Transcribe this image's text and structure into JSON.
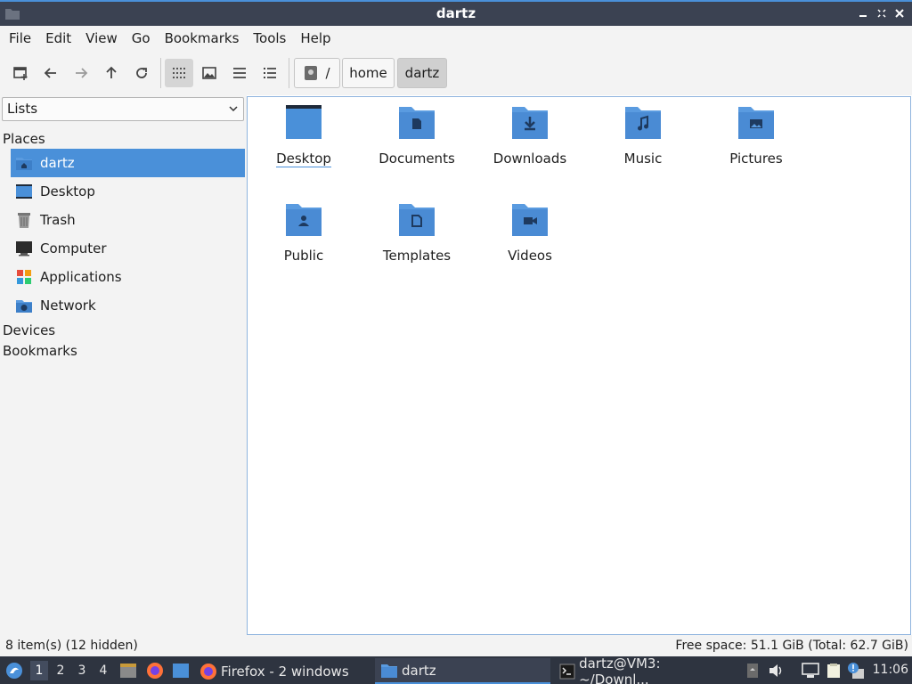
{
  "window": {
    "title": "dartz"
  },
  "menu": [
    "File",
    "Edit",
    "View",
    "Go",
    "Bookmarks",
    "Tools",
    "Help"
  ],
  "toolbar": {
    "buttons": [
      "new-window-icon",
      "back-icon",
      "forward-icon",
      "up-icon",
      "reload-icon",
      "icon-view-icon",
      "thumbnail-view-icon",
      "compact-view-icon",
      "detailed-list-view-icon"
    ],
    "active_view": "icon-view",
    "breadcrumbs": [
      "/",
      "home",
      "dartz"
    ]
  },
  "sidebar": {
    "combo": "Lists",
    "sections": {
      "places": "Places",
      "devices": "Devices",
      "bookmarks": "Bookmarks"
    },
    "places": [
      {
        "label": "dartz",
        "icon": "home-folder-icon",
        "selected": true
      },
      {
        "label": "Desktop",
        "icon": "desktop-icon"
      },
      {
        "label": "Trash",
        "icon": "trash-icon"
      },
      {
        "label": "Computer",
        "icon": "computer-icon"
      },
      {
        "label": "Applications",
        "icon": "applications-icon"
      },
      {
        "label": "Network",
        "icon": "network-icon"
      }
    ]
  },
  "files": [
    {
      "name": "Desktop",
      "icon": "desktop-folder-icon"
    },
    {
      "name": "Documents",
      "icon": "documents-folder-icon"
    },
    {
      "name": "Downloads",
      "icon": "downloads-folder-icon"
    },
    {
      "name": "Music",
      "icon": "music-folder-icon"
    },
    {
      "name": "Pictures",
      "icon": "pictures-folder-icon"
    },
    {
      "name": "Public",
      "icon": "public-folder-icon"
    },
    {
      "name": "Templates",
      "icon": "templates-folder-icon"
    },
    {
      "name": "Videos",
      "icon": "videos-folder-icon"
    }
  ],
  "status": {
    "left": "8 item(s) (12 hidden)",
    "right": "Free space: 51.1 GiB (Total: 62.7 GiB)"
  },
  "taskbar": {
    "workspaces": [
      "1",
      "2",
      "3",
      "4"
    ],
    "tasks": [
      {
        "label": "Firefox - 2 windows",
        "icon": "firefox-icon"
      },
      {
        "label": "dartz",
        "icon": "folder-icon",
        "active": true
      },
      {
        "label": "dartz@VM3: ~/Downl...",
        "icon": "terminal-icon"
      }
    ],
    "clock": "11:06"
  },
  "colors": {
    "accent": "#4a90d9",
    "folder": "#4a90d9",
    "taskbar": "#2e3440"
  }
}
